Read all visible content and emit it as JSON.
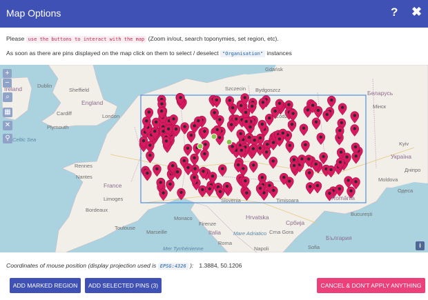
{
  "dialog": {
    "title": "Map Options",
    "help_glyph": "?",
    "close_glyph": "✖"
  },
  "instructions": {
    "line1_prefix": "Please ",
    "line1_code": "use the buttons to interact with the map",
    "line1_suffix": " (Zoom in/out, search toponymies, set region, etc).",
    "line2_prefix": "As soon as there are pins displayed on the map click on them to select / deselect ",
    "line2_code": "\"Organisation\"",
    "line2_suffix": " instances"
  },
  "map_controls": {
    "zoom_in": "+",
    "zoom_out": "−",
    "search": "⌕",
    "select_region": "▦",
    "clear": "✕",
    "pin": "⚲",
    "info": "i"
  },
  "map_labels": [
    {
      "text": "Ireland",
      "kind": "country"
    },
    {
      "text": "Dublin",
      "kind": "city"
    },
    {
      "text": "Sheffield",
      "kind": "city"
    },
    {
      "text": "England",
      "kind": "country"
    },
    {
      "text": "Cardiff",
      "kind": "city"
    },
    {
      "text": "London",
      "kind": "city"
    },
    {
      "text": "Plymouth",
      "kind": "city"
    },
    {
      "text": "Rennes",
      "kind": "city"
    },
    {
      "text": "Nantes",
      "kind": "city"
    },
    {
      "text": "France",
      "kind": "country"
    },
    {
      "text": "Limoges",
      "kind": "city"
    },
    {
      "text": "Bordeaux",
      "kind": "city"
    },
    {
      "text": "Toulouse",
      "kind": "city"
    },
    {
      "text": "Marseille",
      "kind": "city"
    },
    {
      "text": "Monaco",
      "kind": "city"
    },
    {
      "text": "Firenze",
      "kind": "city"
    },
    {
      "text": "Italia",
      "kind": "country"
    },
    {
      "text": "Roma",
      "kind": "city"
    },
    {
      "text": "Napoli",
      "kind": "city"
    },
    {
      "text": "Hrvatska",
      "kind": "country"
    },
    {
      "text": "Timișoara",
      "kind": "city"
    },
    {
      "text": "România",
      "kind": "country"
    },
    {
      "text": "București",
      "kind": "city"
    },
    {
      "text": "Србија",
      "kind": "country"
    },
    {
      "text": "Crna Gora",
      "kind": "city"
    },
    {
      "text": "България",
      "kind": "country"
    },
    {
      "text": "Sofia",
      "kind": "city"
    },
    {
      "text": "Gdańsk",
      "kind": "city"
    },
    {
      "text": "Szczecin",
      "kind": "city"
    },
    {
      "text": "Bydgoszcz",
      "kind": "city"
    },
    {
      "text": "Łódź",
      "kind": "city"
    },
    {
      "text": "Беларусь",
      "kind": "country"
    },
    {
      "text": "Мінск",
      "kind": "city"
    },
    {
      "text": "Kyiv",
      "kind": "city"
    },
    {
      "text": "Україна",
      "kind": "country"
    },
    {
      "text": "Дніпро",
      "kind": "city"
    },
    {
      "text": "Moldova",
      "kind": "city"
    },
    {
      "text": "Одеса",
      "kind": "city"
    },
    {
      "text": "Slovenia",
      "kind": "city"
    },
    {
      "text": "Celtic Sea",
      "kind": "sea"
    },
    {
      "text": "Mer Tyrrhénienne",
      "kind": "sea"
    },
    {
      "text": "Mare Adriatico",
      "kind": "sea"
    }
  ],
  "coordinates": {
    "label_prefix": "Coordinates of mouse position (display projection used is ",
    "projection": "EPSG:4326",
    "label_suffix": " ):",
    "value": "1.3884, 50.1206"
  },
  "buttons": {
    "add_marked_region": "ADD MARKED REGION",
    "add_selected_pins": "ADD SELECTED PINS (3)",
    "cancel": "CANCEL & DON'T APPLY ANYTHING"
  },
  "colors": {
    "header": "#3f51b5",
    "cancel": "#ec407a",
    "pin": "#d81b60",
    "pin_selected": "#8bc34a",
    "region_border": "#4a90e2"
  }
}
